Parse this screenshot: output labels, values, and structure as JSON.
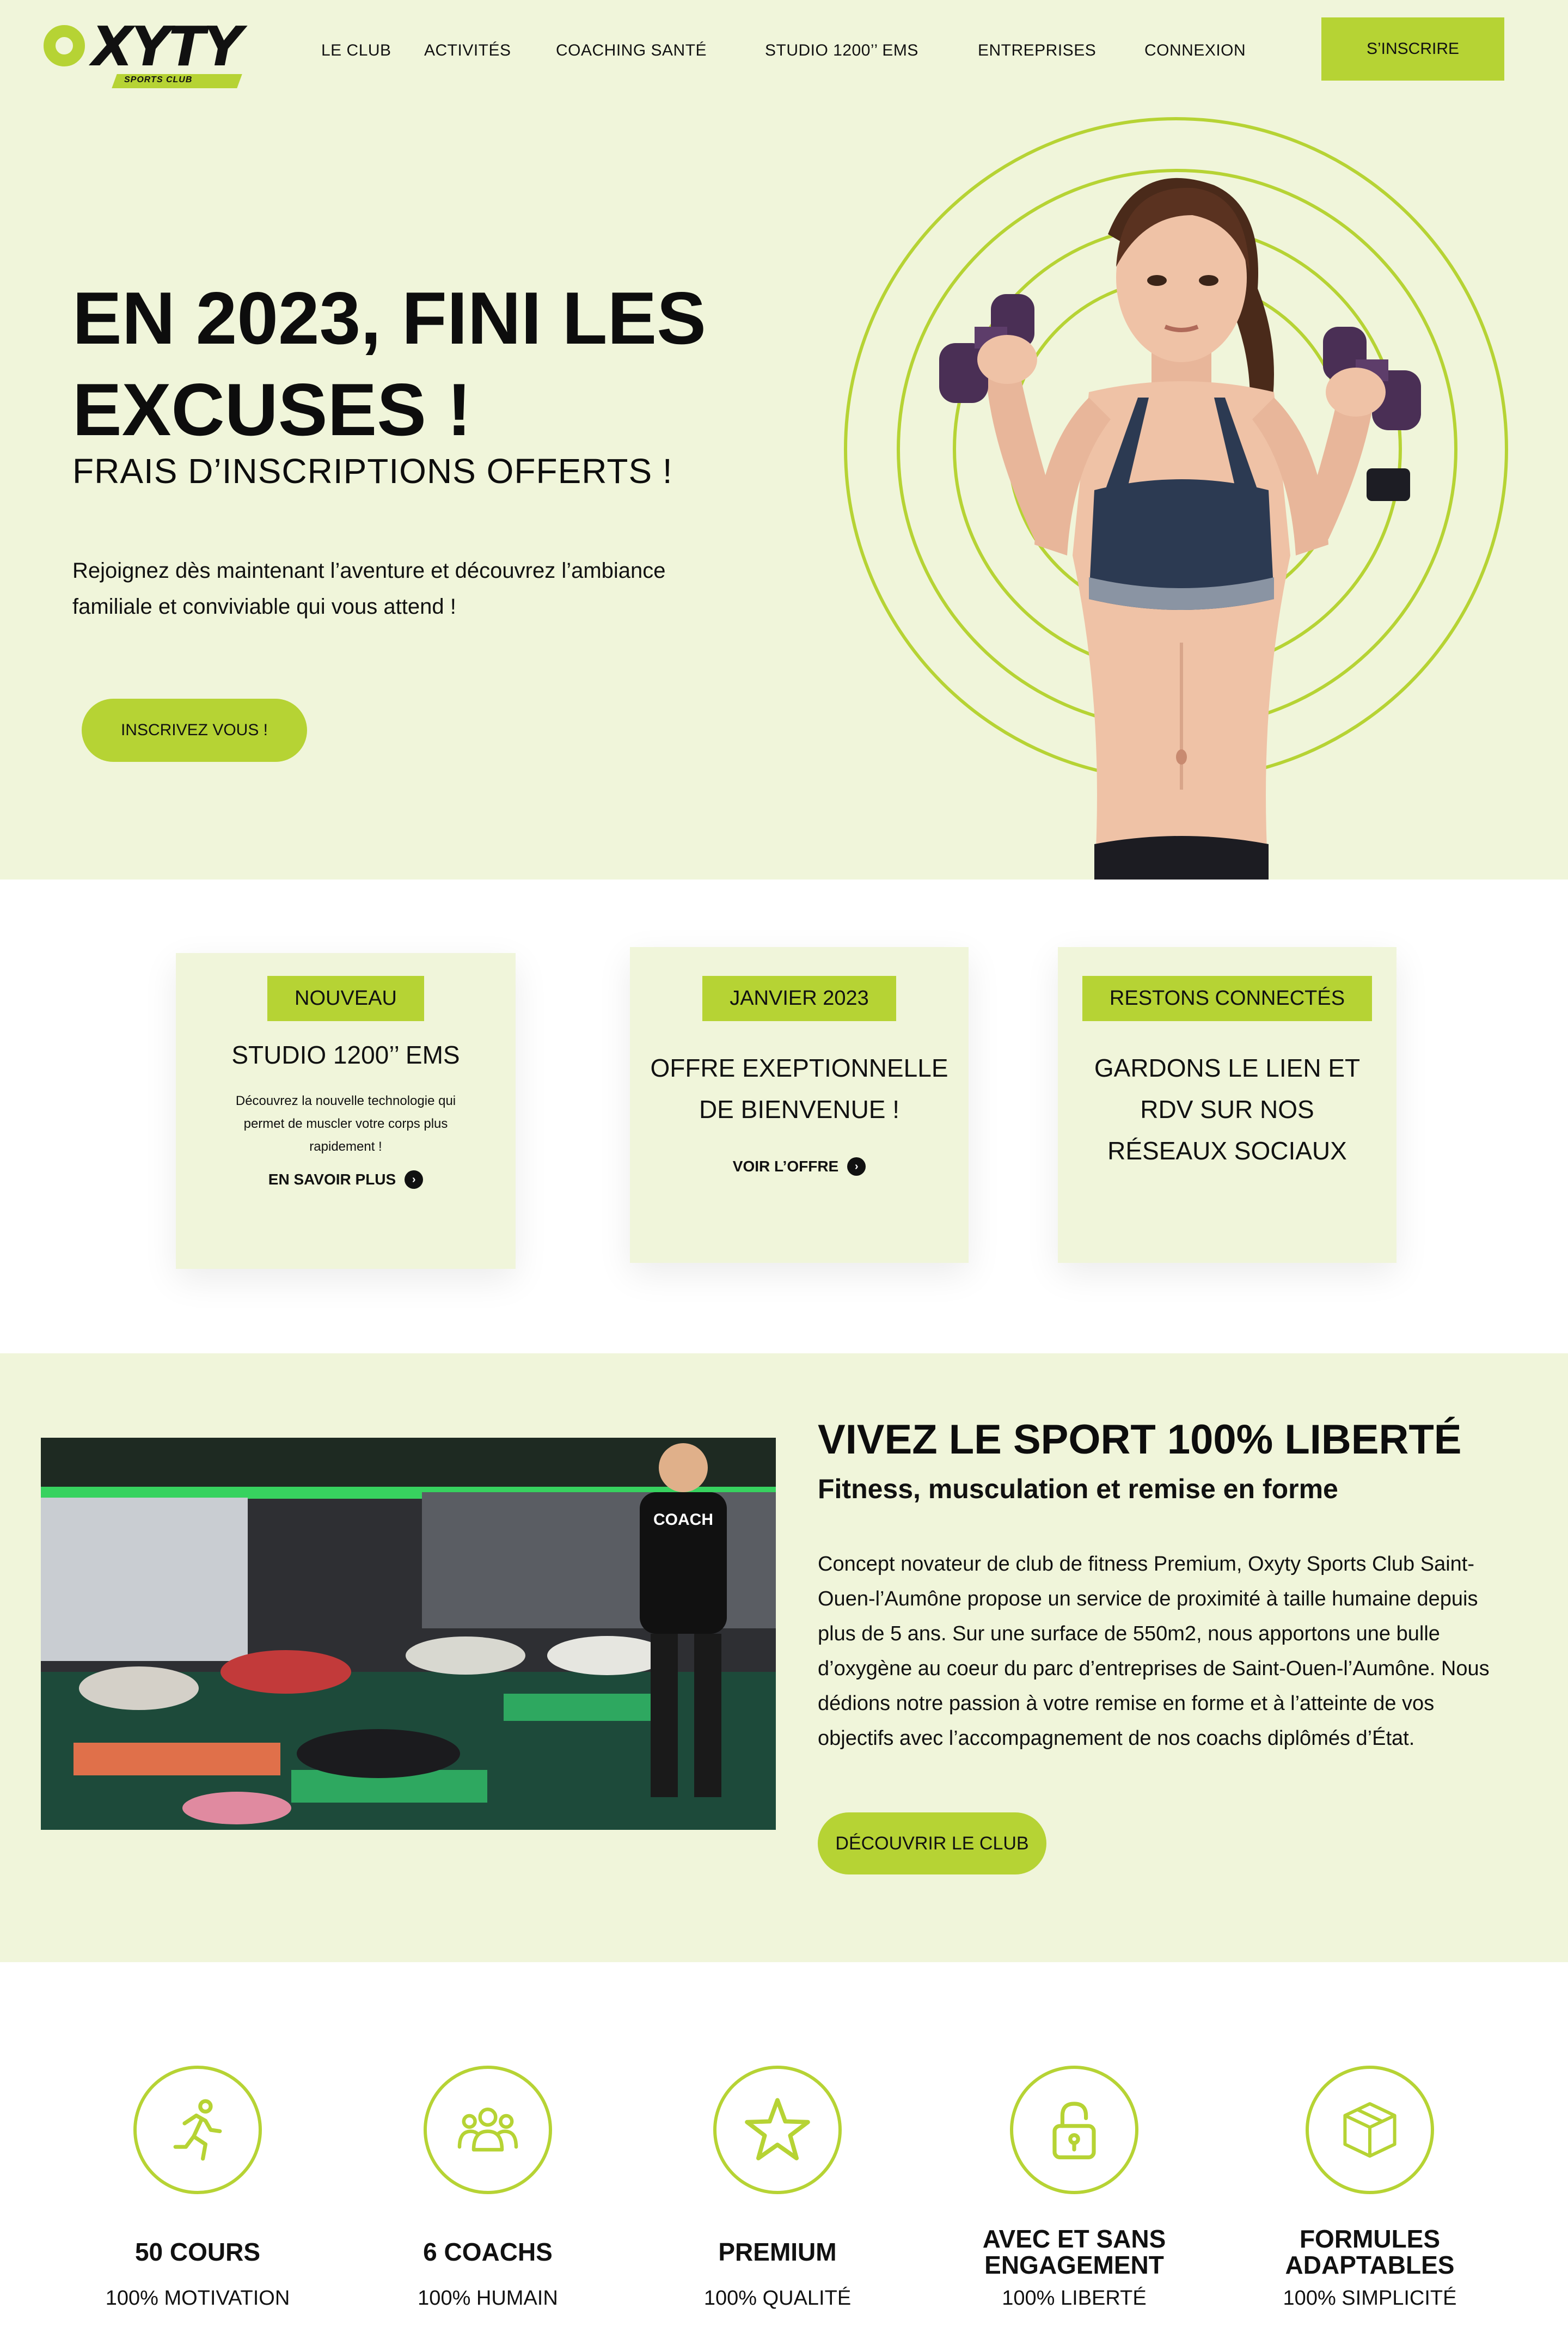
{
  "brand": {
    "name": "OXYTY",
    "tagline": "SPORTS CLUB",
    "accent": "#b6d334",
    "background": "#f0f5da"
  },
  "nav": {
    "items": [
      "LE CLUB",
      "ACTIVITÉS",
      "COACHING SANTÉ",
      "STUDIO 1200’’ EMS",
      "ENTREPRISES",
      "CONNEXION"
    ],
    "cta": "S’INSCRIRE"
  },
  "hero": {
    "title": "EN 2023, FINI LES EXCUSES !",
    "subtitle": "FRAIS D’INSCRIPTIONS OFFERTS !",
    "text": "Rejoignez dès maintenant l’aventure et découvrez l’ambiance familiale et conviviable qui vous attend !",
    "button": "INSCRIVEZ VOUS !"
  },
  "cards": [
    {
      "badge": "NOUVEAU",
      "title": "STUDIO 1200’’ EMS",
      "desc": "Découvrez la nouvelle technologie qui permet de muscler votre corps plus rapidement !",
      "link": "EN SAVOIR PLUS"
    },
    {
      "badge": "JANVIER 2023",
      "title": "OFFRE EXEPTIONNELLE DE BIENVENUE !",
      "link": "VOIR L’OFFRE"
    },
    {
      "badge": "RESTONS CONNECTÉS",
      "title": "GARDONS LE LIEN ET RDV SUR NOS RÉSEAUX SOCIAUX"
    }
  ],
  "about": {
    "photo_label": "COACH",
    "title": "VIVEZ LE SPORT 100% LIBERTÉ",
    "subtitle": "Fitness, musculation et remise en forme",
    "text": "Concept novateur de club de fitness Premium, Oxyty Sports Club Saint-Ouen-l’Aumône propose un service de proximité à taille humaine depuis plus de 5 ans. Sur une surface de 550m2, nous apportons une bulle d’oxygène au coeur du parc d’entreprises de Saint-Ouen-l’Aumône. Nous dédions notre passion à votre remise en forme et à l’atteinte de vos objectifs avec l’accompagnement de nos coachs diplômés d’État.",
    "button": "DÉCOUVRIR LE CLUB"
  },
  "features": [
    {
      "icon": "running-person-icon",
      "title": "50 COURS",
      "text": "100% MOTIVATION"
    },
    {
      "icon": "group-icon",
      "title": "6 COACHS",
      "text": "100% HUMAIN"
    },
    {
      "icon": "star-icon",
      "title": "PREMIUM",
      "text": "100% QUALITÉ"
    },
    {
      "icon": "unlock-icon",
      "title": "AVEC ET SANS ENGAGEMENT",
      "text": "100% LIBERTÉ"
    },
    {
      "icon": "box-icon",
      "title": "FORMULES ADAPTABLES",
      "text": "100% SIMPLICITÉ"
    }
  ]
}
